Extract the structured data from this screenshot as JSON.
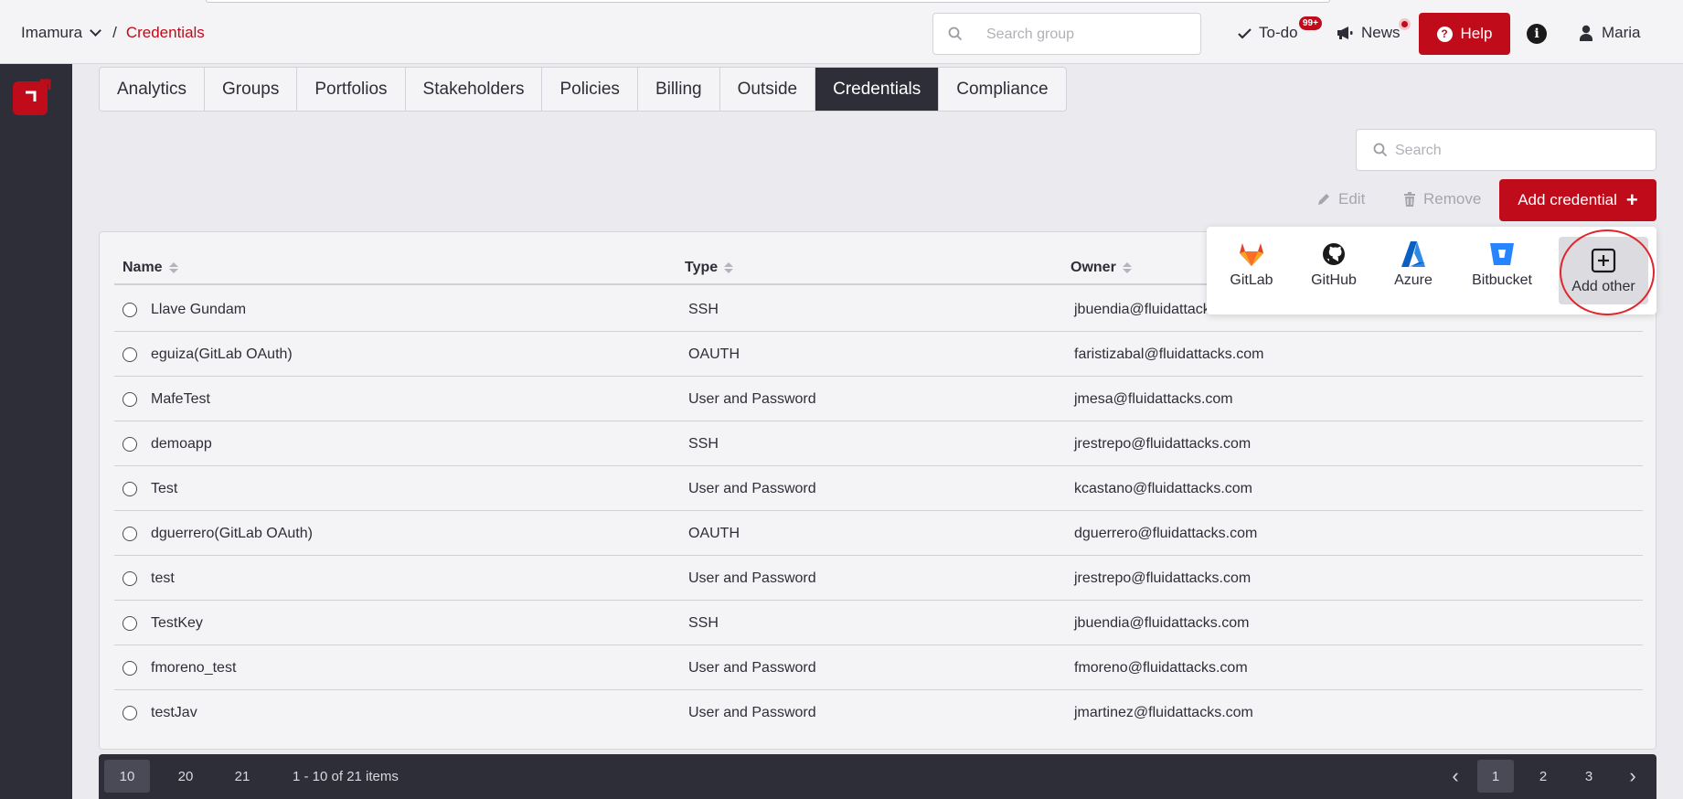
{
  "topbar": {
    "org": "Imamura",
    "separator": "/",
    "current": "Credentials",
    "search_placeholder": "Search group",
    "todo_label": "To-do",
    "todo_badge": "99+",
    "news_label": "News",
    "help_label": "Help",
    "user_name": "Maria"
  },
  "tabs": [
    "Analytics",
    "Groups",
    "Portfolios",
    "Stakeholders",
    "Policies",
    "Billing",
    "Outside",
    "Credentials",
    "Compliance"
  ],
  "active_tab": "Credentials",
  "search": {
    "placeholder": "Search"
  },
  "actions": {
    "edit": "Edit",
    "remove": "Remove",
    "add": "Add credential"
  },
  "table": {
    "headers": {
      "name": "Name",
      "type": "Type",
      "owner": "Owner"
    },
    "rows": [
      {
        "name": "Llave Gundam",
        "type": "SSH",
        "owner": "jbuendia@fluidattacks.com"
      },
      {
        "name": "eguiza(GitLab OAuth)",
        "type": "OAUTH",
        "owner": "faristizabal@fluidattacks.com"
      },
      {
        "name": "MafeTest",
        "type": "User and Password",
        "owner": "jmesa@fluidattacks.com"
      },
      {
        "name": "demoapp",
        "type": "SSH",
        "owner": "jrestrepo@fluidattacks.com"
      },
      {
        "name": "Test",
        "type": "User and Password",
        "owner": "kcastano@fluidattacks.com"
      },
      {
        "name": "dguerrero(GitLab OAuth)",
        "type": "OAUTH",
        "owner": "dguerrero@fluidattacks.com"
      },
      {
        "name": "test",
        "type": "User and Password",
        "owner": "jrestrepo@fluidattacks.com"
      },
      {
        "name": "TestKey",
        "type": "SSH",
        "owner": "jbuendia@fluidattacks.com"
      },
      {
        "name": "fmoreno_test",
        "type": "User and Password",
        "owner": "fmoreno@fluidattacks.com"
      },
      {
        "name": "testJav",
        "type": "User and Password",
        "owner": "jmartinez@fluidattacks.com"
      }
    ]
  },
  "providers": [
    "GitLab",
    "GitHub",
    "Azure",
    "Bitbucket",
    "Add other"
  ],
  "pagination": {
    "sizes": [
      "10",
      "20",
      "21"
    ],
    "active_size": "10",
    "range": "1 - 10 of 21 items",
    "pages": [
      "1",
      "2",
      "3"
    ],
    "active_page": "1",
    "prev": "‹",
    "next": "›"
  },
  "colors": {
    "brand_red": "#bf0b1a",
    "dark": "#2e2e38",
    "highlight": "#e0252d"
  }
}
